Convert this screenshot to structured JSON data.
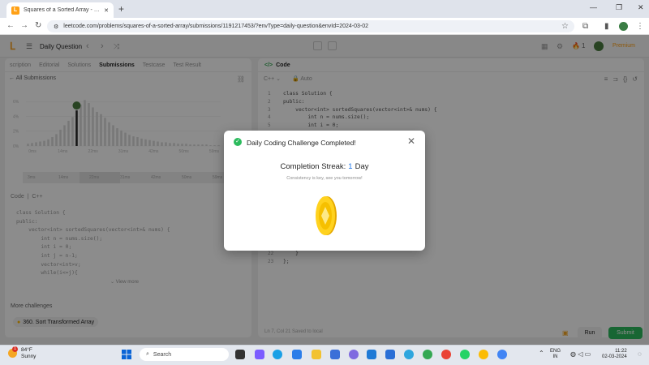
{
  "browser": {
    "tab_title": "Squares of a Sorted Array - Lee",
    "url": "leetcode.com/problems/squares-of-a-sorted-array/submissions/1191217453/?envType=daily-question&envId=2024-03-02",
    "new_tab_label": "+"
  },
  "header": {
    "title": "Daily Question",
    "premium_label": "Premium",
    "streak_count": "1"
  },
  "left": {
    "tabs": [
      "scription",
      "Editorial",
      "Solutions",
      "Submissions",
      "Testcase",
      "Test Result"
    ],
    "all_submissions": "All Submissions",
    "y_ticks": [
      "6%",
      "4%",
      "2%",
      "0%"
    ],
    "x_ticks": [
      "0ms",
      "14ms",
      "22ms",
      "31ms",
      "42ms",
      "50ms",
      "59ms"
    ],
    "mini_ticks": [
      "3ms",
      "14ms",
      "22ms",
      "31ms",
      "42ms",
      "50ms",
      "59ms"
    ],
    "code_label": "Code",
    "code_lang": "C++",
    "code_lines": [
      "class Solution {",
      "public:",
      "    vector<int> sortedSquares(vector<int>& nums) {",
      "        int n = nums.size();",
      "        int i = 0;",
      "        int j = n-1;",
      "        vector<int>v;",
      "        while(i<=j){"
    ],
    "view_more": "View more",
    "more_challenges": "More challenges",
    "challenge_chip": "360. Sort Transformed Array"
  },
  "right": {
    "code_tab": "Code",
    "language": "C++",
    "auto": "Auto",
    "line_numbers": [
      "1",
      "2",
      "3",
      "4",
      "5",
      "6"
    ],
    "code_lines": [
      "class Solution {",
      "public:",
      "    vector<int> sortedSquares(vector<int>& nums) {",
      "        int n = nums.size();",
      "        int i = 0;",
      ""
    ],
    "tail_numbers": [
      "22",
      "23"
    ],
    "tail_code": [
      "    }",
      "};"
    ],
    "status": "Ln 7, Col 21    Saved to local",
    "run_label": "Run",
    "submit_label": "Submit"
  },
  "modal": {
    "title": "Daily Coding Challenge Completed!",
    "streak_prefix": "Completion Streak:",
    "streak_value": "1",
    "streak_unit": "Day",
    "subtitle": "Consistency is key, see you tomorrow!"
  },
  "taskbar": {
    "temperature": "84°F",
    "weather": "Sunny",
    "search_label": "Search",
    "lang_top": "ENG",
    "lang_bottom": "IN",
    "time": "11:22",
    "date": "02-03-2024",
    "notif_count": "1"
  },
  "chart_data": {
    "type": "bar",
    "x_labels": [
      "0ms",
      "14ms",
      "22ms",
      "31ms",
      "42ms",
      "50ms",
      "59ms"
    ],
    "y_ticks": [
      "6%",
      "4%",
      "2%",
      "0%"
    ],
    "ylim": [
      0,
      7
    ],
    "values": [
      0.3,
      0.4,
      0.5,
      0.6,
      0.7,
      0.9,
      1.2,
      1.6,
      2.2,
      2.8,
      3.4,
      3.9,
      4.8,
      5.6,
      6.2,
      5.8,
      5.2,
      4.6,
      4.3,
      3.8,
      3.2,
      2.8,
      2.4,
      2.1,
      1.8,
      1.5,
      1.3,
      1.2,
      1.0,
      0.9,
      0.8,
      0.7,
      0.6,
      0.5,
      0.5,
      0.4,
      0.4,
      0.3,
      0.3,
      0.3,
      0.2,
      0.2,
      0.2,
      0.2,
      0.2,
      0.1,
      0.1,
      0.1
    ],
    "highlight_index": 12,
    "grid": true
  }
}
